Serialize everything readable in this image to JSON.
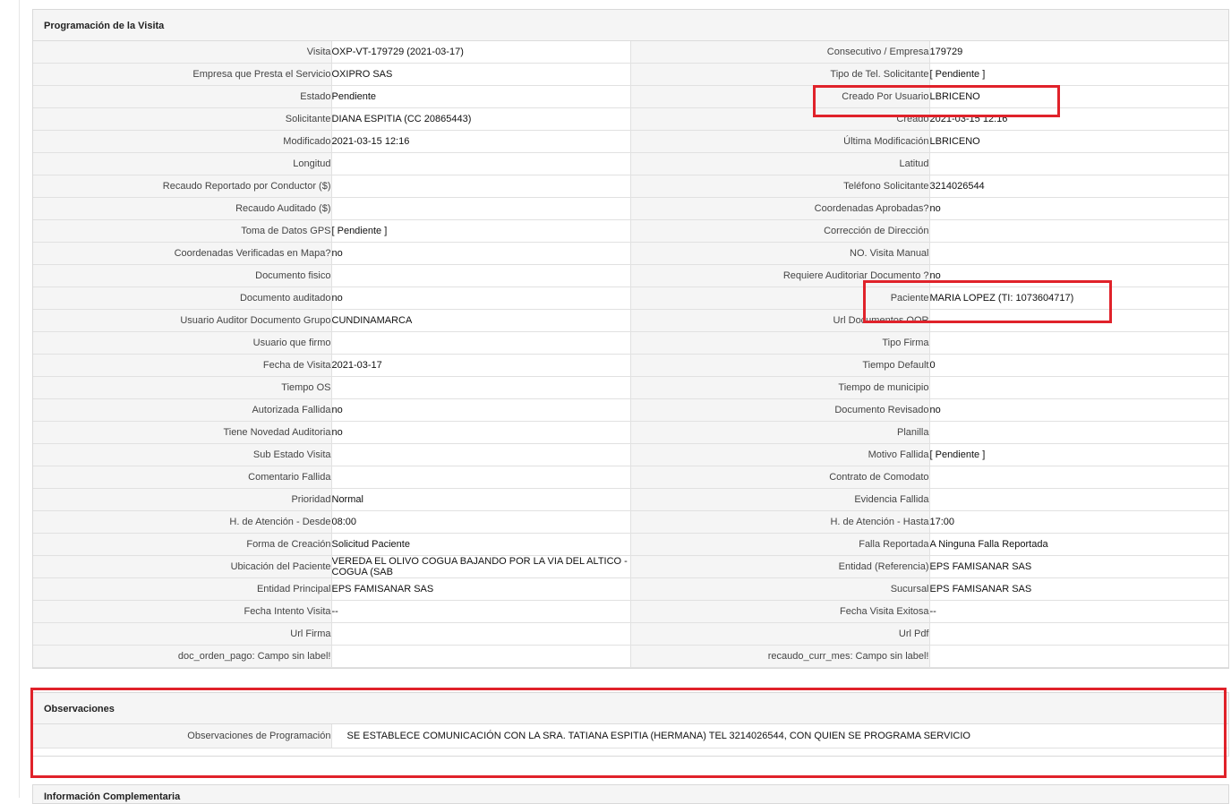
{
  "visit_panel": {
    "title": "Programación de la Visita",
    "rows": [
      {
        "l1": "Visita",
        "v1": "OXP-VT-179729 (2021-03-17)",
        "l2": "Consecutivo / Empresa",
        "v2": "179729"
      },
      {
        "l1": "Empresa que Presta el Servicio",
        "v1": "OXIPRO SAS",
        "l2": "Tipo de Tel. Solicitante",
        "v2": "[ Pendiente ]"
      },
      {
        "l1": "Estado",
        "v1": "Pendiente",
        "l2": "Creado Por Usuario",
        "v2": "LBRICENO"
      },
      {
        "l1": "Solicitante",
        "v1": "DIANA ESPITIA (CC 20865443)",
        "l2": "Creado",
        "v2": "2021-03-15 12:16"
      },
      {
        "l1": "Modificado",
        "v1": "2021-03-15 12:16",
        "l2": "Última Modificación",
        "v2": " LBRICENO"
      },
      {
        "l1": "Longitud",
        "v1": "",
        "l2": "Latitud",
        "v2": ""
      },
      {
        "l1": "Recaudo Reportado por Conductor ($)",
        "v1": "",
        "l2": "Teléfono Solicitante",
        "v2": "3214026544"
      },
      {
        "l1": "Recaudo Auditado ($)",
        "v1": "",
        "l2": "Coordenadas Aprobadas?",
        "v2": " no"
      },
      {
        "l1": "Toma de Datos GPS",
        "v1": "[ Pendiente ]",
        "l2": "Corrección de Dirección",
        "v2": ""
      },
      {
        "l1": "Coordenadas Verificadas en Mapa?",
        "v1": " no",
        "l2": "NO. Visita Manual",
        "v2": ""
      },
      {
        "l1": "Documento fisico",
        "v1": "",
        "l2": "Requiere Auditoriar Documento ?",
        "v2": " no"
      },
      {
        "l1": "Documento auditado",
        "v1": " no",
        "l2": "Paciente",
        "v2": "MARIA LOPEZ (TI: 1073604717)"
      },
      {
        "l1": "Usuario Auditor Documento Grupo",
        "v1": "CUNDINAMARCA",
        "l2": "Url Documentos OOR",
        "v2": ""
      },
      {
        "l1": "Usuario que firmo",
        "v1": "",
        "l2": "Tipo Firma",
        "v2": ""
      },
      {
        "l1": "Fecha de Visita",
        "v1": " 2021-03-17",
        "l2": "Tiempo Default",
        "v2": "0"
      },
      {
        "l1": "Tiempo OS",
        "v1": "",
        "l2": "Tiempo de municipio",
        "v2": ""
      },
      {
        "l1": "Autorizada Fallida",
        "v1": " no",
        "l2": "Documento Revisado",
        "v2": " no"
      },
      {
        "l1": "Tiene Novedad Auditoria",
        "v1": " no",
        "l2": "Planilla",
        "v2": ""
      },
      {
        "l1": "Sub Estado Visita",
        "v1": "",
        "l2": "Motivo Fallida",
        "v2": "[ Pendiente ]"
      },
      {
        "l1": "Comentario Fallida",
        "v1": "",
        "l2": "Contrato de Comodato",
        "v2": ""
      },
      {
        "l1": "Prioridad",
        "v1": "Normal",
        "l2": "Evidencia Fallida",
        "v2": ""
      },
      {
        "l1": "H. de Atención - Desde",
        "v1": "08:00",
        "l2": "H. de Atención - Hasta",
        "v2": "17:00"
      },
      {
        "l1": "Forma de Creación",
        "v1": "Solicitud Paciente",
        "l2": "Falla Reportada",
        "v2": "A Ninguna Falla Reportada"
      },
      {
        "l1": "Ubicación del Paciente",
        "v1": "VEREDA EL OLIVO COGUA BAJANDO POR LA VIA DEL ALTICO - COGUA (SAB",
        "l2": "Entidad (Referencia)",
        "v2": "EPS FAMISANAR SAS"
      },
      {
        "l1": "Entidad Principal",
        "v1": "EPS FAMISANAR SAS",
        "l2": "Sucursal",
        "v2": "EPS FAMISANAR SAS"
      },
      {
        "l1": "Fecha Intento Visita",
        "v1": " --",
        "l2": "Fecha Visita Exitosa",
        "v2": " --"
      },
      {
        "l1": "Url Firma",
        "v1": "",
        "l2": "Url Pdf",
        "v2": ""
      },
      {
        "l1": "doc_orden_pago: Campo sin label!",
        "v1": "",
        "l2": "recaudo_curr_mes: Campo sin label!",
        "v2": ""
      }
    ]
  },
  "observations_panel": {
    "title": "Observaciones",
    "label": "Observaciones de Programación",
    "value": "SE ESTABLECE COMUNICACIÓN CON LA SRA. TATIANA ESPITIA (HERMANA) TEL 3214026544, CON QUIEN SE PROGRAMA SERVICIO"
  },
  "next_panel": {
    "title": "Información Complementaria"
  },
  "colors": {
    "highlight": "#e0222a",
    "label_bg": "#f5f5f5",
    "border": "#e1e1e1"
  }
}
